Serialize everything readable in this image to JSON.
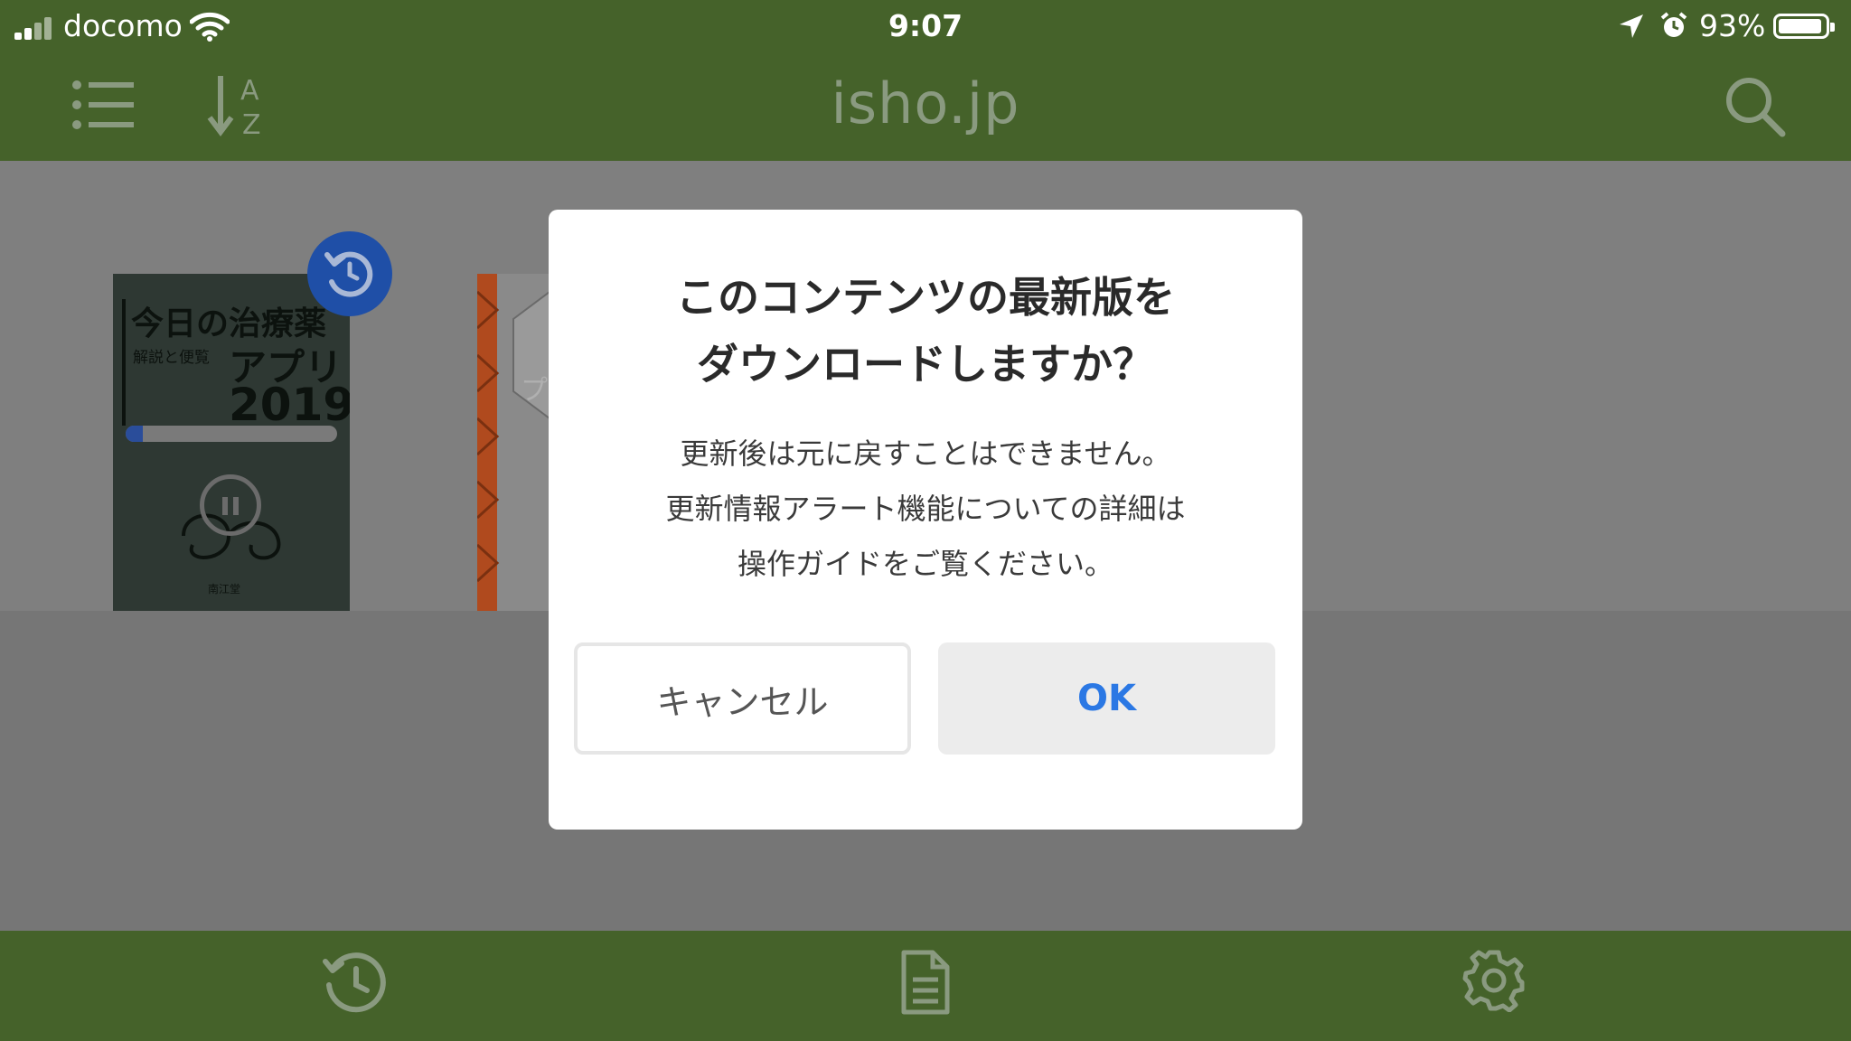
{
  "status_bar": {
    "carrier": "docomo",
    "time": "9:07",
    "battery_percent": "93%",
    "battery_level": 0.93
  },
  "header": {
    "title": "isho.jp",
    "menu_icon": "list-icon",
    "sort_icon": "sort-az-icon",
    "search_icon": "search-icon"
  },
  "library": {
    "books": [
      {
        "cover_title": "今日の治療薬",
        "cover_subtitle": "解説と便覧",
        "cover_app": "アプリ",
        "cover_year": "2019",
        "publisher": "南江堂",
        "download_progress": 0.08
      },
      {
        "cover_text": "プ"
      }
    ]
  },
  "dialog": {
    "title_line1": "このコンテンツの最新版を",
    "title_line2": "ダウンロードしますか？",
    "message_line1": "更新後は元に戻すことはできません。",
    "message_line2": "更新情報アラート機能についての詳細は",
    "message_line3": "操作ガイドをご覧ください。",
    "cancel_label": "キャンセル",
    "ok_label": "OK"
  },
  "tabbar": {
    "items": [
      {
        "icon": "history-icon"
      },
      {
        "icon": "document-icon"
      },
      {
        "icon": "gear-icon"
      }
    ]
  },
  "colors": {
    "header_green": "#45622a",
    "badge_blue": "#1f4fa7",
    "ok_blue": "#2b78e4"
  }
}
